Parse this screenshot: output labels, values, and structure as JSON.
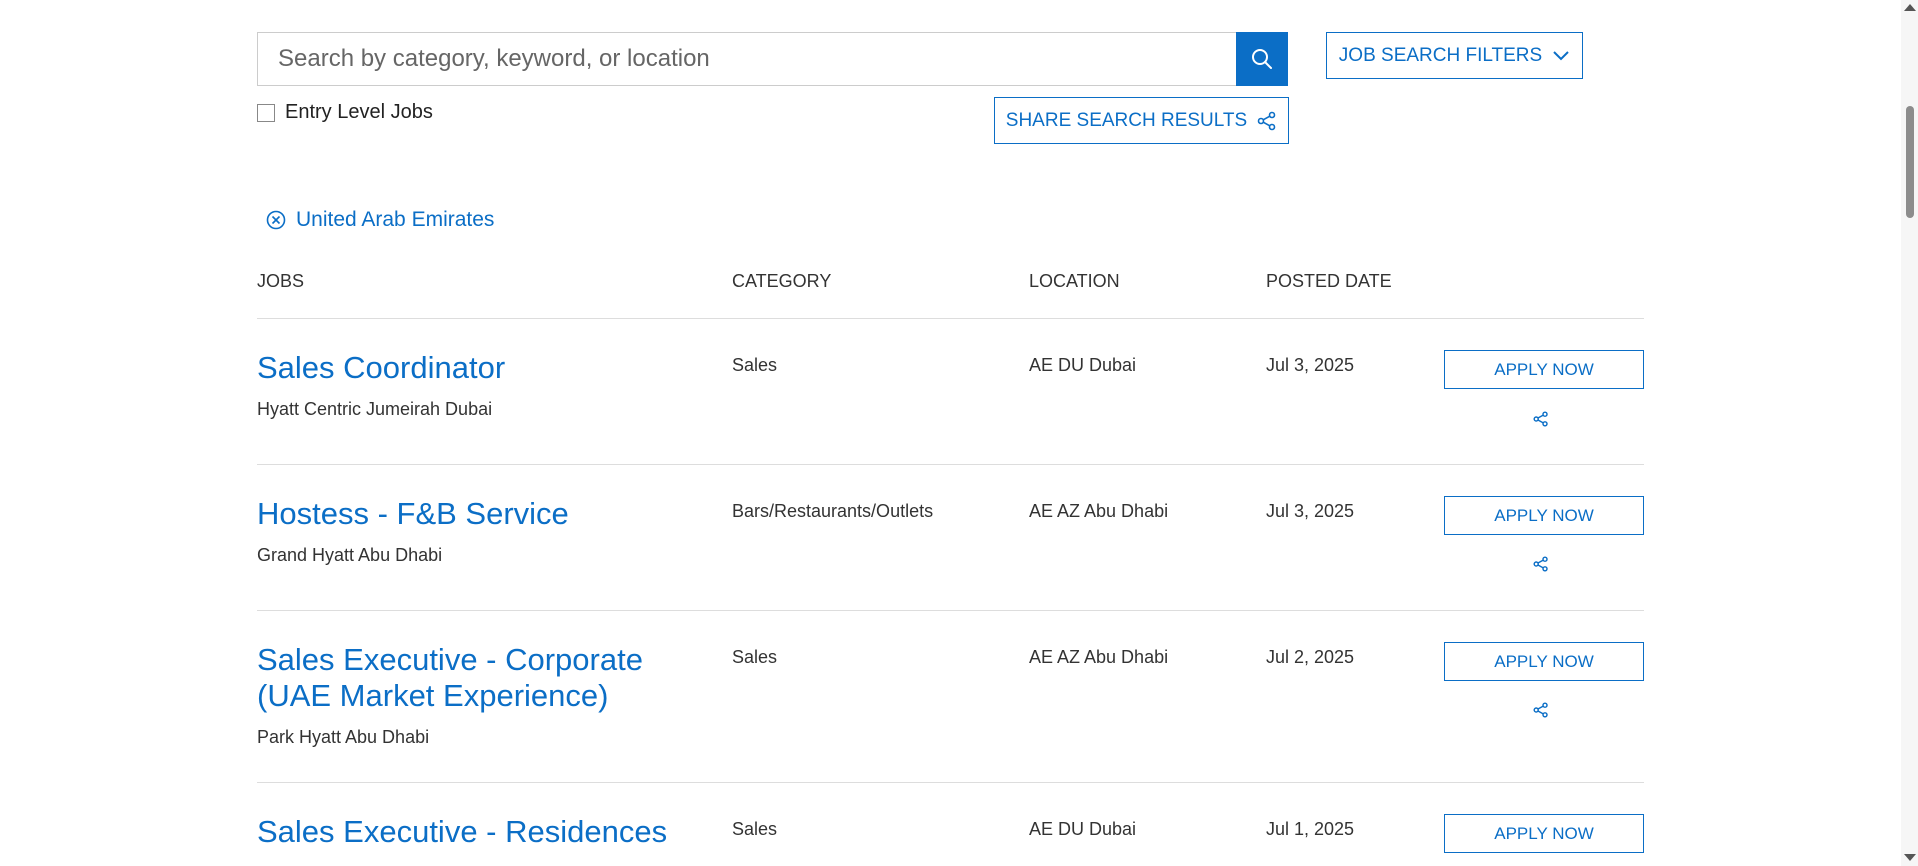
{
  "search": {
    "placeholder": "Search by category, keyword, or location",
    "value": ""
  },
  "filters_button": {
    "label": "JOB SEARCH FILTERS"
  },
  "entry_level": {
    "label": "Entry Level Jobs",
    "checked": false
  },
  "share_results": {
    "label": "SHARE SEARCH RESULTS"
  },
  "active_filter": {
    "label": "United Arab Emirates"
  },
  "table": {
    "headers": {
      "jobs": "JOBS",
      "category": "CATEGORY",
      "location": "LOCATION",
      "posted_date": "POSTED DATE"
    },
    "apply_label": "APPLY NOW",
    "rows": [
      {
        "title": "Sales Coordinator",
        "hotel": "Hyatt Centric Jumeirah Dubai",
        "category": "Sales",
        "location": "AE DU Dubai",
        "posted": "Jul 3, 2025"
      },
      {
        "title": "Hostess - F&B Service",
        "hotel": "Grand Hyatt Abu Dhabi",
        "category": "Bars/Restaurants/Outlets",
        "location": "AE AZ Abu Dhabi",
        "posted": "Jul 3, 2025"
      },
      {
        "title": "Sales Executive - Corporate (UAE Market Experience)",
        "hotel": "Park Hyatt Abu Dhabi",
        "category": "Sales",
        "location": "AE AZ Abu Dhabi",
        "posted": "Jul 2, 2025"
      },
      {
        "title": "Sales Executive - Residences",
        "hotel": "",
        "category": "Sales",
        "location": "AE DU Dubai",
        "posted": "Jul 1, 2025"
      }
    ]
  },
  "icons": {
    "search": "search-icon",
    "chevron": "chevron-down-icon",
    "share": "share-icon",
    "remove": "close-circle-icon"
  },
  "colors": {
    "accent": "#0b6ec6",
    "divider": "#dddddd"
  }
}
